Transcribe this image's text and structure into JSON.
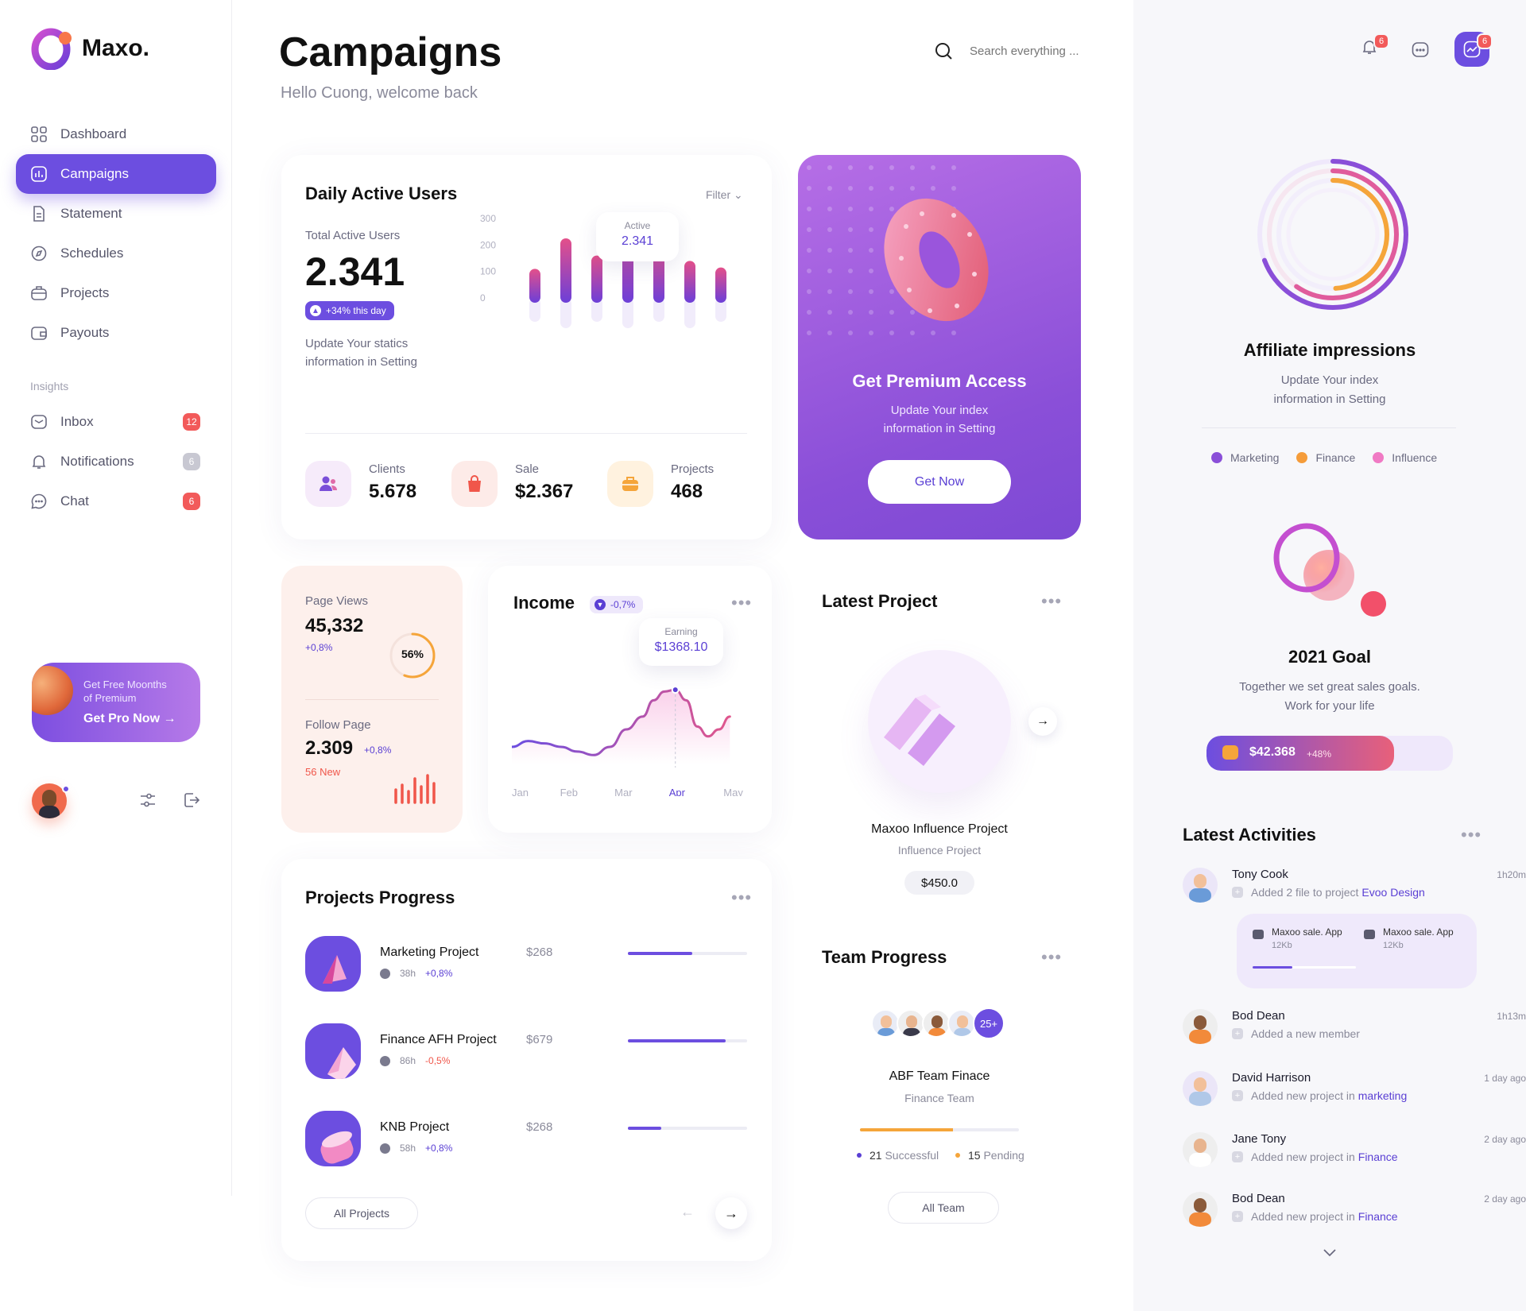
{
  "brand": {
    "name": "Maxo."
  },
  "header": {
    "title": "Campaigns",
    "subtitle": "Hello Cuong, welcome back",
    "search_placeholder": "Search everything ..."
  },
  "topbar": {
    "notifications_count": "6",
    "profile_count": "6"
  },
  "sidebar": {
    "items": [
      {
        "label": "Dashboard"
      },
      {
        "label": "Campaigns"
      },
      {
        "label": "Statement"
      },
      {
        "label": "Schedules"
      },
      {
        "label": "Projects"
      },
      {
        "label": "Payouts"
      }
    ],
    "insights_label": "Insights",
    "insights": [
      {
        "label": "Inbox",
        "count": "12"
      },
      {
        "label": "Notifications",
        "count": "6"
      },
      {
        "label": "Chat",
        "count": "6"
      }
    ],
    "promo": {
      "line1": "Get Free Moonths",
      "line2": "of Premium",
      "cta": "Get Pro Now"
    }
  },
  "dau": {
    "title": "Daily Active Users",
    "filter": "Filter",
    "total_label": "Total Active Users",
    "total_value": "2.341",
    "change": "+34% this day",
    "note_line1": "Update Your statics",
    "note_line2": "information in Setting",
    "tooltip_label": "Active",
    "tooltip_value": "2.341",
    "stats": [
      {
        "label": "Clients",
        "value": "5.678"
      },
      {
        "label": "Sale",
        "value": "$2.367"
      },
      {
        "label": "Projects",
        "value": "468"
      }
    ]
  },
  "premium": {
    "title": "Get Premium Access",
    "line1": "Update Your index",
    "line2": "information in Setting",
    "cta": "Get Now"
  },
  "views": {
    "page_label": "Page Views",
    "page_value": "45,332",
    "page_change": "+0,8%",
    "ring_value": "56%",
    "follow_label": "Follow Page",
    "follow_value": "2.309",
    "follow_change": "+0,8%",
    "follow_new": "56 New"
  },
  "income": {
    "title": "Income",
    "change": "-0,7%",
    "tooltip_label": "Earning",
    "tooltip_value": "$1368.10"
  },
  "latest_project": {
    "title": "Latest Project",
    "name": "Maxoo Influence Project",
    "type": "Influence Project",
    "price": "$450.0"
  },
  "team": {
    "title": "Team Progress",
    "more": "25+",
    "name": "ABF Team Finace",
    "type": "Finance Team",
    "successful": "21",
    "successful_label": "Successful",
    "pending": "15",
    "pending_label": "Pending",
    "cta": "All Team"
  },
  "projects": {
    "title": "Projects Progress",
    "cta": "All Projects",
    "items": [
      {
        "name": "Marketing Project",
        "hours": "38h",
        "change": "+0,8%",
        "price": "$268",
        "progress": 0.54
      },
      {
        "name": "Finance AFH Project",
        "hours": "86h",
        "change": "-0,5%",
        "price": "$679",
        "progress": 0.82
      },
      {
        "name": "KNB Project",
        "hours": "58h",
        "change": "+0,8%",
        "price": "$268",
        "progress": 0.28
      }
    ]
  },
  "affiliate": {
    "title": "Affiliate impressions",
    "line1": "Update Your index",
    "line2": "information in Setting",
    "legend": [
      "Marketing",
      "Finance",
      "Influence"
    ],
    "colors": {
      "marketing": "#8a4fd8",
      "finance": "#f59c3a",
      "influence": "#f07ac4"
    }
  },
  "goal": {
    "title": "2021 Goal",
    "line1": "Together we set great sales goals.",
    "line2": "Work for your life",
    "amount": "$42.368",
    "change": "+48%",
    "progress": 0.76
  },
  "activities": {
    "title": "Latest Activities",
    "files": [
      {
        "name": "Maxoo sale. App",
        "size": "12Kb"
      },
      {
        "name": "Maxoo sale. App",
        "size": "12Kb"
      }
    ],
    "items": [
      {
        "name": "Tony Cook",
        "time": "1h20m",
        "desc": "Added 2 file to project",
        "link": "Evoo Design"
      },
      {
        "name": "Bod Dean",
        "time": "1h13m",
        "desc": "Added a new member",
        "link": ""
      },
      {
        "name": "David Harrison",
        "time": "1 day ago",
        "desc": "Added new project in",
        "link": "marketing"
      },
      {
        "name": "Jane Tony",
        "time": "2 day ago",
        "desc": "Added new project in",
        "link": "Finance"
      },
      {
        "name": "Bod Dean",
        "time": "2 day ago",
        "desc": "Added new project in",
        "link": "Finance"
      }
    ]
  },
  "chart_data": [
    {
      "type": "bar",
      "title": "Daily Active Users",
      "yticks": [
        "300",
        "200",
        "100",
        "0"
      ],
      "values": [
        110,
        225,
        160,
        280,
        195,
        140,
        115
      ],
      "ylim": [
        0,
        300
      ]
    },
    {
      "type": "line",
      "title": "Income",
      "categories": [
        "Jan",
        "Feb",
        "Mar",
        "Apr",
        "May"
      ],
      "highlight": "Apr",
      "x": [
        0,
        0.3,
        0.6,
        0.9,
        1.2,
        1.5,
        1.8,
        2.1,
        2.4,
        2.6,
        2.8,
        3.0,
        3.2,
        3.4,
        3.6,
        3.8,
        4.0
      ],
      "y": [
        30,
        40,
        36,
        30,
        22,
        16,
        30,
        60,
        82,
        110,
        125,
        128,
        110,
        65,
        48,
        60,
        82
      ],
      "ylim": [
        0,
        150
      ]
    }
  ]
}
